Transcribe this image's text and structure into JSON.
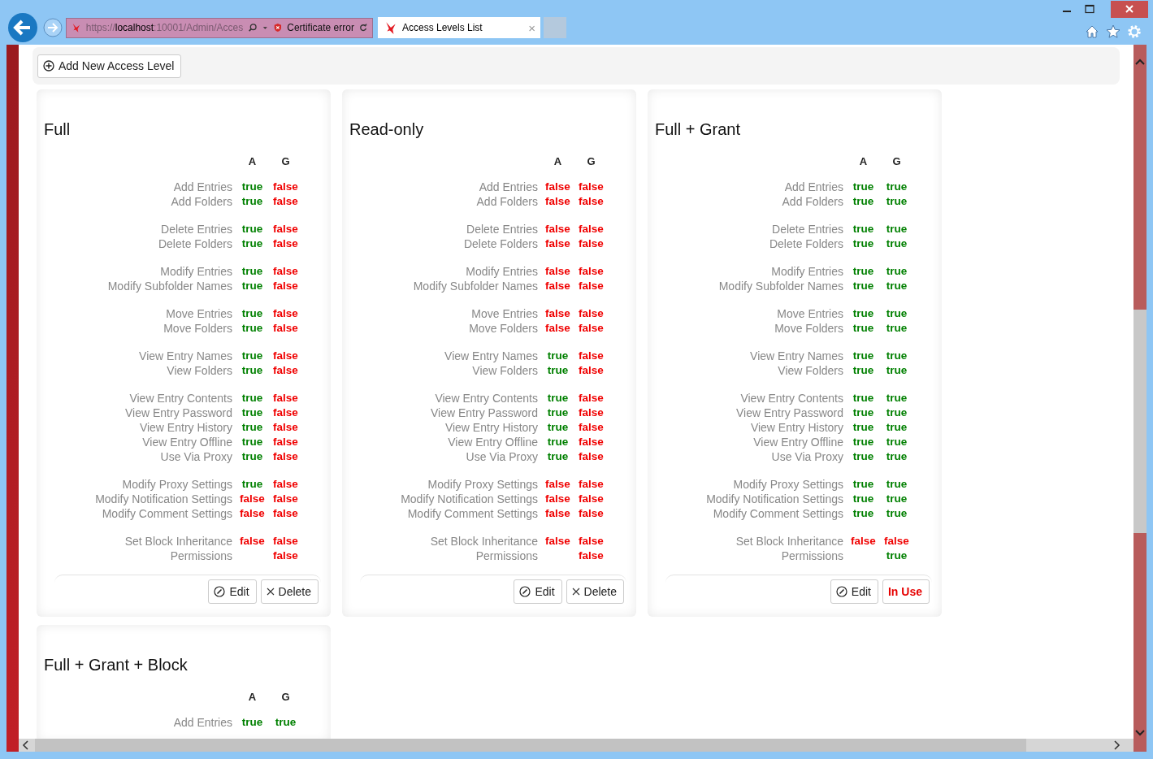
{
  "browser": {
    "address": {
      "url": "https://**localhost**:10001/Admin/Acces"
    },
    "certificate": "Certificate error",
    "tabs": [
      {
        "title": "Access Levels List",
        "selected": true,
        "close": "×"
      }
    ]
  },
  "toolbar": {
    "add_button": "Add New Access Level"
  },
  "cards": [
    {
      "title": "Full",
      "columns": [
        "A",
        "G"
      ],
      "groups": [
        [
          {
            "label": "Add Entries",
            "a": {
              "text": "true",
              "on": true
            },
            "g": {
              "text": "false",
              "on": false
            }
          },
          {
            "label": "Add Folders",
            "a": {
              "text": "true",
              "on": true
            },
            "g": {
              "text": "false",
              "on": false
            }
          }
        ],
        [
          {
            "label": "Delete Entries",
            "a": {
              "text": "true",
              "on": true
            },
            "g": {
              "text": "false",
              "on": false
            }
          },
          {
            "label": "Delete Folders",
            "a": {
              "text": "true",
              "on": true
            },
            "g": {
              "text": "false",
              "on": false
            }
          }
        ],
        [
          {
            "label": "Modify Entries",
            "a": {
              "text": "true",
              "on": true
            },
            "g": {
              "text": "false",
              "on": false
            }
          },
          {
            "label": "Modify Subfolder Names",
            "a": {
              "text": "true",
              "on": true
            },
            "g": {
              "text": "false",
              "on": false
            }
          }
        ],
        [
          {
            "label": "Move Entries",
            "a": {
              "text": "true",
              "on": true
            },
            "g": {
              "text": "false",
              "on": false
            }
          },
          {
            "label": "Move Folders",
            "a": {
              "text": "true",
              "on": true
            },
            "g": {
              "text": "false",
              "on": false
            }
          }
        ],
        [
          {
            "label": "View Entry Names",
            "a": {
              "text": "true",
              "on": true
            },
            "g": {
              "text": "false",
              "on": false
            }
          },
          {
            "label": "View Folders",
            "a": {
              "text": "true",
              "on": true
            },
            "g": {
              "text": "false",
              "on": false
            }
          }
        ],
        [
          {
            "label": "View Entry Contents",
            "a": {
              "text": "true",
              "on": true
            },
            "g": {
              "text": "false",
              "on": false
            }
          },
          {
            "label": "View Entry Password",
            "a": {
              "text": "true",
              "on": true
            },
            "g": {
              "text": "false",
              "on": false
            }
          },
          {
            "label": "View Entry History",
            "a": {
              "text": "true",
              "on": true
            },
            "g": {
              "text": "false",
              "on": false
            }
          },
          {
            "label": "View Entry Offline",
            "a": {
              "text": "true",
              "on": true
            },
            "g": {
              "text": "false",
              "on": false
            }
          },
          {
            "label": "Use Via Proxy",
            "a": {
              "text": "true",
              "on": true
            },
            "g": {
              "text": "false",
              "on": false
            }
          }
        ],
        [
          {
            "label": "Modify Proxy Settings",
            "a": {
              "text": "true",
              "on": true
            },
            "g": {
              "text": "false",
              "on": false
            }
          },
          {
            "label": "Modify Notification Settings",
            "a": {
              "text": "false",
              "on": false
            },
            "g": {
              "text": "false",
              "on": false
            }
          },
          {
            "label": "Modify Comment Settings",
            "a": {
              "text": "false",
              "on": false
            },
            "g": {
              "text": "false",
              "on": false
            }
          }
        ],
        [
          {
            "label": "Set Block Inheritance",
            "a": {
              "text": "false",
              "on": false
            },
            "g": {
              "text": "false",
              "on": false
            }
          },
          {
            "label": "Permissions",
            "g": {
              "text": "false",
              "on": false
            }
          }
        ]
      ],
      "buttons": [
        {
          "kind": "edit",
          "label": "Edit"
        },
        {
          "kind": "delete",
          "label": "Delete"
        }
      ]
    },
    {
      "title": "Read-only",
      "columns": [
        "A",
        "G"
      ],
      "groups": [
        [
          {
            "label": "Add Entries",
            "a": {
              "text": "false",
              "on": false
            },
            "g": {
              "text": "false",
              "on": false
            }
          },
          {
            "label": "Add Folders",
            "a": {
              "text": "false",
              "on": false
            },
            "g": {
              "text": "false",
              "on": false
            }
          }
        ],
        [
          {
            "label": "Delete Entries",
            "a": {
              "text": "false",
              "on": false
            },
            "g": {
              "text": "false",
              "on": false
            }
          },
          {
            "label": "Delete Folders",
            "a": {
              "text": "false",
              "on": false
            },
            "g": {
              "text": "false",
              "on": false
            }
          }
        ],
        [
          {
            "label": "Modify Entries",
            "a": {
              "text": "false",
              "on": false
            },
            "g": {
              "text": "false",
              "on": false
            }
          },
          {
            "label": "Modify Subfolder Names",
            "a": {
              "text": "false",
              "on": false
            },
            "g": {
              "text": "false",
              "on": false
            }
          }
        ],
        [
          {
            "label": "Move Entries",
            "a": {
              "text": "false",
              "on": false
            },
            "g": {
              "text": "false",
              "on": false
            }
          },
          {
            "label": "Move Folders",
            "a": {
              "text": "false",
              "on": false
            },
            "g": {
              "text": "false",
              "on": false
            }
          }
        ],
        [
          {
            "label": "View Entry Names",
            "a": {
              "text": "true",
              "on": true
            },
            "g": {
              "text": "false",
              "on": false
            }
          },
          {
            "label": "View Folders",
            "a": {
              "text": "true",
              "on": true
            },
            "g": {
              "text": "false",
              "on": false
            }
          }
        ],
        [
          {
            "label": "View Entry Contents",
            "a": {
              "text": "true",
              "on": true
            },
            "g": {
              "text": "false",
              "on": false
            }
          },
          {
            "label": "View Entry Password",
            "a": {
              "text": "true",
              "on": true
            },
            "g": {
              "text": "false",
              "on": false
            }
          },
          {
            "label": "View Entry History",
            "a": {
              "text": "true",
              "on": true
            },
            "g": {
              "text": "false",
              "on": false
            }
          },
          {
            "label": "View Entry Offline",
            "a": {
              "text": "true",
              "on": true
            },
            "g": {
              "text": "false",
              "on": false
            }
          },
          {
            "label": "Use Via Proxy",
            "a": {
              "text": "true",
              "on": true
            },
            "g": {
              "text": "false",
              "on": false
            }
          }
        ],
        [
          {
            "label": "Modify Proxy Settings",
            "a": {
              "text": "false",
              "on": false
            },
            "g": {
              "text": "false",
              "on": false
            }
          },
          {
            "label": "Modify Notification Settings",
            "a": {
              "text": "false",
              "on": false
            },
            "g": {
              "text": "false",
              "on": false
            }
          },
          {
            "label": "Modify Comment Settings",
            "a": {
              "text": "false",
              "on": false
            },
            "g": {
              "text": "false",
              "on": false
            }
          }
        ],
        [
          {
            "label": "Set Block Inheritance",
            "a": {
              "text": "false",
              "on": false
            },
            "g": {
              "text": "false",
              "on": false
            }
          },
          {
            "label": "Permissions",
            "g": {
              "text": "false",
              "on": false
            }
          }
        ]
      ],
      "buttons": [
        {
          "kind": "edit",
          "label": "Edit"
        },
        {
          "kind": "delete",
          "label": "Delete"
        }
      ]
    },
    {
      "title": "Full + Grant",
      "columns": [
        "A",
        "G"
      ],
      "groups": [
        [
          {
            "label": "Add Entries",
            "a": {
              "text": "true",
              "on": true
            },
            "g": {
              "text": "true",
              "on": true
            }
          },
          {
            "label": "Add Folders",
            "a": {
              "text": "true",
              "on": true
            },
            "g": {
              "text": "true",
              "on": true
            }
          }
        ],
        [
          {
            "label": "Delete Entries",
            "a": {
              "text": "true",
              "on": true
            },
            "g": {
              "text": "true",
              "on": true
            }
          },
          {
            "label": "Delete Folders",
            "a": {
              "text": "true",
              "on": true
            },
            "g": {
              "text": "true",
              "on": true
            }
          }
        ],
        [
          {
            "label": "Modify Entries",
            "a": {
              "text": "true",
              "on": true
            },
            "g": {
              "text": "true",
              "on": true
            }
          },
          {
            "label": "Modify Subfolder Names",
            "a": {
              "text": "true",
              "on": true
            },
            "g": {
              "text": "true",
              "on": true
            }
          }
        ],
        [
          {
            "label": "Move Entries",
            "a": {
              "text": "true",
              "on": true
            },
            "g": {
              "text": "true",
              "on": true
            }
          },
          {
            "label": "Move Folders",
            "a": {
              "text": "true",
              "on": true
            },
            "g": {
              "text": "true",
              "on": true
            }
          }
        ],
        [
          {
            "label": "View Entry Names",
            "a": {
              "text": "true",
              "on": true
            },
            "g": {
              "text": "true",
              "on": true
            }
          },
          {
            "label": "View Folders",
            "a": {
              "text": "true",
              "on": true
            },
            "g": {
              "text": "true",
              "on": true
            }
          }
        ],
        [
          {
            "label": "View Entry Contents",
            "a": {
              "text": "true",
              "on": true
            },
            "g": {
              "text": "true",
              "on": true
            }
          },
          {
            "label": "View Entry Password",
            "a": {
              "text": "true",
              "on": true
            },
            "g": {
              "text": "true",
              "on": true
            }
          },
          {
            "label": "View Entry History",
            "a": {
              "text": "true",
              "on": true
            },
            "g": {
              "text": "true",
              "on": true
            }
          },
          {
            "label": "View Entry Offline",
            "a": {
              "text": "true",
              "on": true
            },
            "g": {
              "text": "true",
              "on": true
            }
          },
          {
            "label": "Use Via Proxy",
            "a": {
              "text": "true",
              "on": true
            },
            "g": {
              "text": "true",
              "on": true
            }
          }
        ],
        [
          {
            "label": "Modify Proxy Settings",
            "a": {
              "text": "true",
              "on": true
            },
            "g": {
              "text": "true",
              "on": true
            }
          },
          {
            "label": "Modify Notification Settings",
            "a": {
              "text": "true",
              "on": true
            },
            "g": {
              "text": "true",
              "on": true
            }
          },
          {
            "label": "Modify Comment Settings",
            "a": {
              "text": "true",
              "on": true
            },
            "g": {
              "text": "true",
              "on": true
            }
          }
        ],
        [
          {
            "label": "Set Block Inheritance",
            "a": {
              "text": "false",
              "on": false
            },
            "g": {
              "text": "false",
              "on": false
            }
          },
          {
            "label": "Permissions",
            "g": {
              "text": "true",
              "on": true
            }
          }
        ]
      ],
      "buttons": [
        {
          "kind": "edit",
          "label": "Edit"
        },
        {
          "kind": "in-use",
          "label": "In Use"
        }
      ]
    },
    {
      "title": "Full + Grant + Block",
      "columns": [
        "A",
        "G"
      ],
      "groups": [
        [
          {
            "label": "Add Entries",
            "a": {
              "text": "true",
              "on": true
            },
            "g": {
              "text": "true",
              "on": true
            }
          }
        ]
      ]
    }
  ]
}
